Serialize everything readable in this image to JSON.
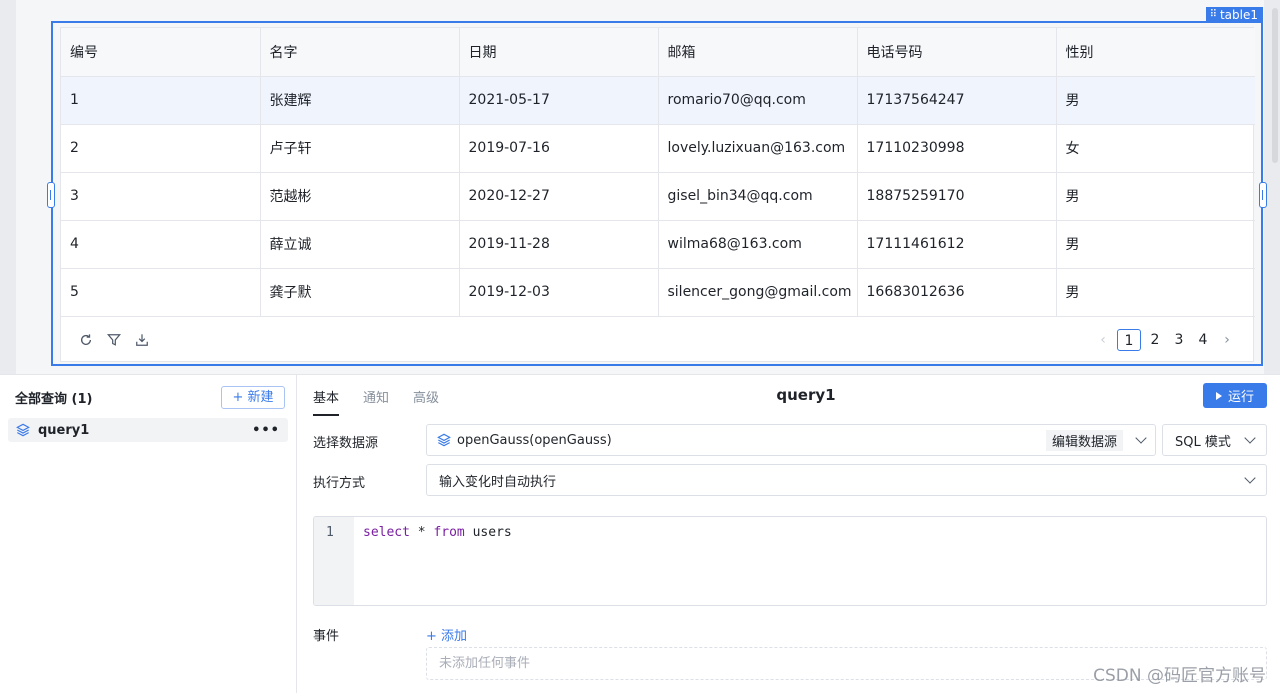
{
  "canvas": {
    "component_tag": "table1",
    "table": {
      "columns": [
        "编号",
        "名字",
        "日期",
        "邮箱",
        "电话号码",
        "性别"
      ],
      "rows": [
        [
          "1",
          "张建辉",
          "2021-05-17",
          "romario70@qq.com",
          "17137564247",
          "男"
        ],
        [
          "2",
          "卢子轩",
          "2019-07-16",
          "lovely.luzixuan@163.com",
          "17110230998",
          "女"
        ],
        [
          "3",
          "范越彬",
          "2020-12-27",
          "gisel_bin34@qq.com",
          "18875259170",
          "男"
        ],
        [
          "4",
          "薛立诚",
          "2019-11-28",
          "wilma68@163.com",
          "17111461612",
          "男"
        ],
        [
          "5",
          "龚子默",
          "2019-12-03",
          "silencer_gong@gmail.com",
          "16683012636",
          "男"
        ]
      ],
      "selected_row": 0,
      "toolbar_icons": [
        "refresh-icon",
        "filter-icon",
        "download-icon"
      ],
      "pagination": {
        "pages": [
          "1",
          "2",
          "3",
          "4"
        ],
        "current": "1"
      }
    }
  },
  "queries": {
    "title": "全部查询 (1)",
    "new_label": "+ 新建",
    "items": [
      {
        "name": "query1",
        "icon": "layers-icon",
        "more": "•••"
      }
    ]
  },
  "editor": {
    "tabs": [
      "基本",
      "通知",
      "高级"
    ],
    "active_tab": "基本",
    "query_name": "query1",
    "run_label": "运行",
    "datasource_label": "选择数据源",
    "datasource_value": "openGauss(openGauss)",
    "edit_datasource_label": "编辑数据源",
    "mode_value": "SQL 模式",
    "exec_label": "执行方式",
    "exec_value": "输入变化时自动执行",
    "code_line_number": "1",
    "code": {
      "kw1": "select",
      "mid": " * ",
      "kw2": "from",
      "rest": " users"
    },
    "events_label": "事件",
    "add_event_label": "+ 添加",
    "events_empty": "未添加任何事件"
  },
  "colors": {
    "accent": "#3a7bea",
    "selected_row": "#eff4fd"
  },
  "watermark": "CSDN @码匠官方账号"
}
